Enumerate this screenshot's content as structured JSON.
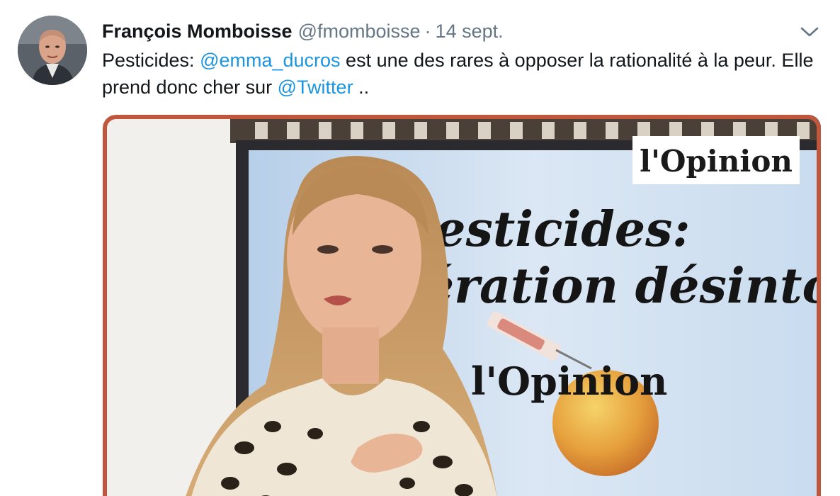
{
  "tweet": {
    "author_name": "François Momboisse",
    "handle": "@fmomboisse",
    "separator": "·",
    "date": "14 sept.",
    "text_before": "Pesticides: ",
    "mention_1": "@emma_ducros",
    "text_middle": " est une des rares à opposer la rationalité à la peur. Elle prend donc cher sur ",
    "mention_2": "@Twitter",
    "text_after": " .."
  },
  "media": {
    "logo_top": "l'Opinion",
    "headline_line1": "Pesticides:",
    "headline_line2": "opération désintox",
    "logo_bottom": "l'Opinion"
  },
  "colors": {
    "link": "#1b95e0",
    "secondary_text": "#657786",
    "media_border": "#c0573c"
  },
  "icons": {
    "caret": "chevron-down-icon"
  }
}
